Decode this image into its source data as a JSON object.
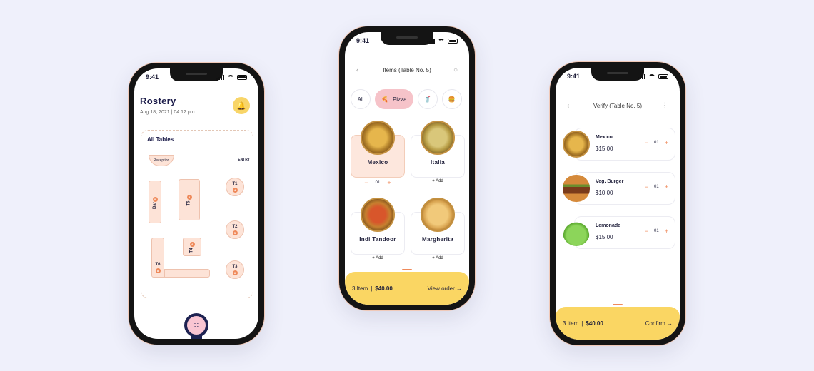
{
  "status": {
    "time": "9:41"
  },
  "phone1": {
    "title": "Rostery",
    "date": "Aug 18, 2021",
    "time": "04:12 pm",
    "section": "All Tables",
    "reception": "Reception",
    "entry": "ENTRY",
    "tables": [
      {
        "label": "Bar",
        "count": "8"
      },
      {
        "label": "T5",
        "count": "8"
      },
      {
        "label": "T1",
        "count": "4"
      },
      {
        "label": "T2",
        "count": "5"
      },
      {
        "label": "T4",
        "count": "4"
      },
      {
        "label": "T6",
        "count": "8"
      },
      {
        "label": "T3",
        "count": "6"
      }
    ]
  },
  "phone2": {
    "title": "Items (Table No. 5)",
    "categories": [
      {
        "label": "All"
      },
      {
        "label": "Pizza",
        "icon": "pizza-icon"
      },
      {
        "label": "",
        "icon": "drink-icon"
      },
      {
        "label": "",
        "icon": "burger-icon"
      }
    ],
    "items": [
      {
        "name": "Mexico",
        "qty": "01",
        "selected": true
      },
      {
        "name": "Italia",
        "action": "Add"
      },
      {
        "name": "Indi Tandoor",
        "action": "Add"
      },
      {
        "name": "Margherita",
        "action": "Add"
      }
    ],
    "cart": {
      "items": "3 Item",
      "total": "$40.00",
      "action": "View order"
    }
  },
  "phone3": {
    "title": "Verify (Table No. 5)",
    "items": [
      {
        "name": "Mexico",
        "price": "$15.00",
        "qty": "01"
      },
      {
        "name": "Veg. Burger",
        "price": "$10.00",
        "qty": "01"
      },
      {
        "name": "Lemonade",
        "price": "$15.00",
        "qty": "01"
      }
    ],
    "cart": {
      "items": "3 Item",
      "total": "$40.00",
      "action": "Confirm"
    }
  },
  "colors": {
    "accent": "#fad663",
    "highlight": "#f6c3c9",
    "orange": "#ef8a5b",
    "navy": "#1e2352"
  }
}
